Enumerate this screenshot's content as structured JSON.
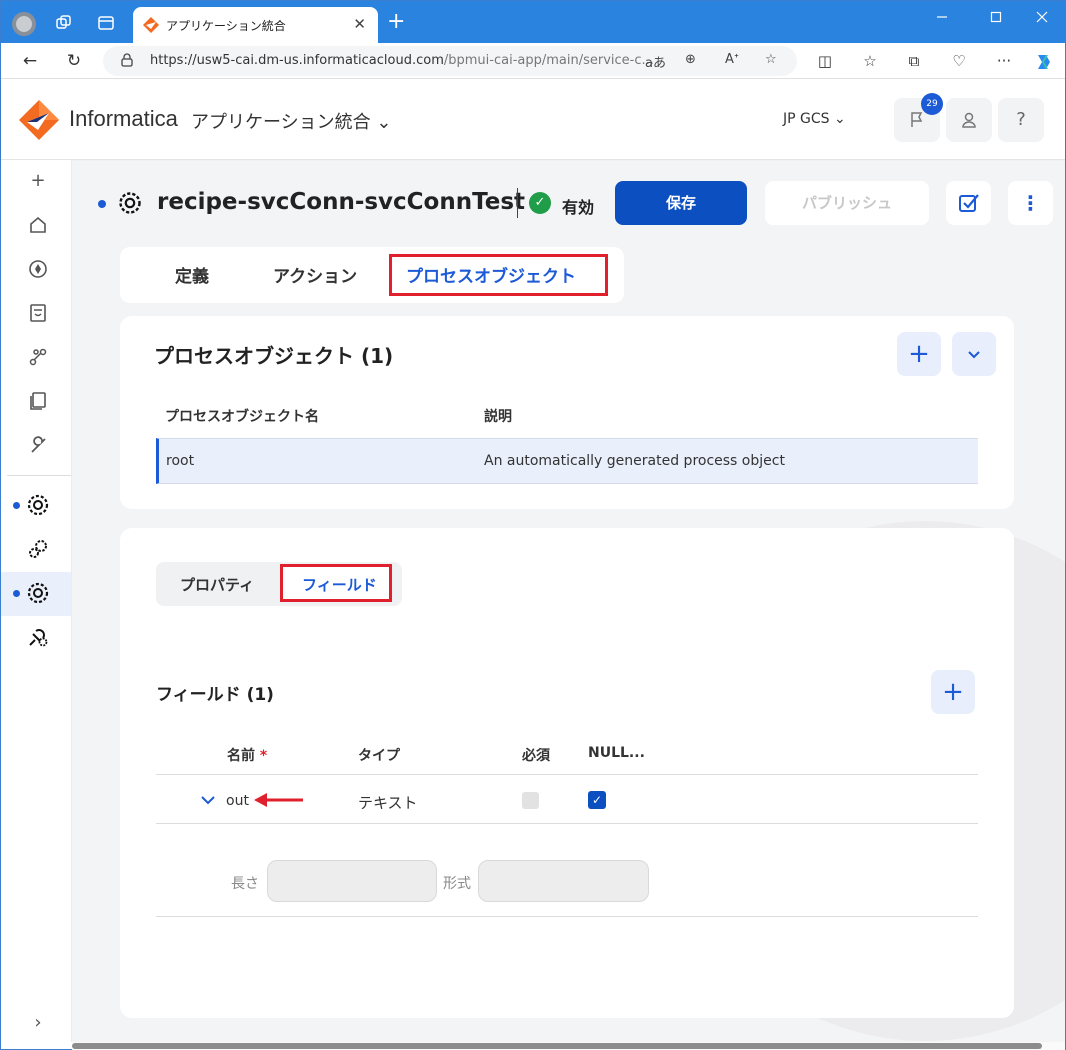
{
  "browser": {
    "tab_title": "アプリケーション統合",
    "url_host": "https://usw5-cai.dm-us.informaticacloud.com",
    "url_path": "/bpmui-cai-app/main/service-c...",
    "close_tab_glyph": "✕",
    "new_tab_glyph": "+",
    "icons": [
      "back-icon",
      "refresh-icon",
      "lock-icon",
      "read-aloud-icon",
      "zoom-icon",
      "text-size-icon",
      "favorite-star-icon",
      "split-screen-icon",
      "favorites-icon",
      "collections-icon",
      "health-icon",
      "more-icon",
      "copilot-icon"
    ]
  },
  "header": {
    "brand": "Informatica",
    "app_name": "アプリケーション統合",
    "org": "JP GCS",
    "notification_count": "29",
    "help_label": "?"
  },
  "nav": {
    "expand_label": "+",
    "collapse_label": "›"
  },
  "page": {
    "title": "recipe-svcConn-svcConnTest",
    "status": "有効",
    "save_label": "保存",
    "publish_label": "パブリッシュ",
    "more_label": "⋮"
  },
  "tabs": [
    "定義",
    "アクション",
    "プロセスオブジェクト"
  ],
  "process_objects": {
    "title": "プロセスオブジェクト (1)",
    "add_label": "+",
    "expand_label": "⌄",
    "columns": [
      "プロセスオブジェクト名",
      "説明"
    ],
    "rows": [
      {
        "name": "root",
        "description": "An automatically generated process object"
      }
    ]
  },
  "sub_tabs": [
    "プロパティ",
    "フィールド"
  ],
  "fields": {
    "title": "フィールド (1)",
    "add_label": "+",
    "columns": {
      "name": "名前",
      "required_mark": "*",
      "type": "タイプ",
      "required": "必須",
      "nullable": "NULL..."
    },
    "rows": [
      {
        "name": "out",
        "type": "テキスト",
        "required": false,
        "nullable": true
      }
    ],
    "length_label": "長さ",
    "format_label": "形式"
  },
  "colors": {
    "accent": "#1c5ad6",
    "save_button": "#0c4fc1",
    "highlight": "#e0202c",
    "status_ok": "#1f9d48"
  }
}
